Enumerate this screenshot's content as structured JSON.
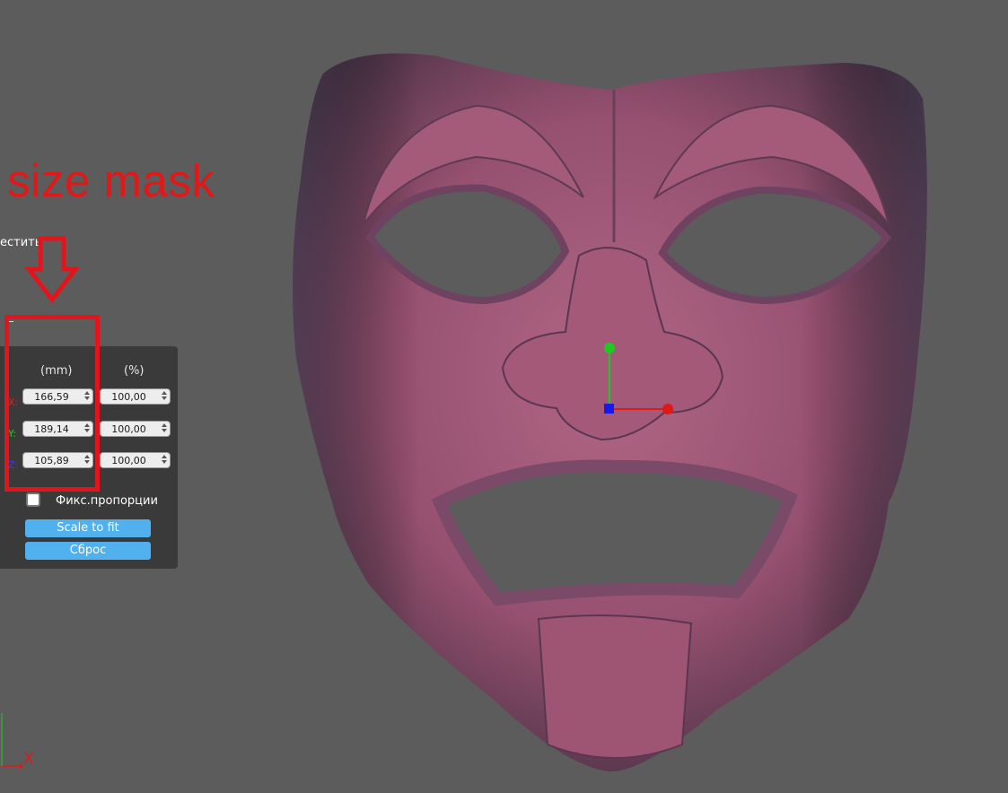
{
  "annotation": {
    "title": "size mask"
  },
  "menu": {
    "truncated_item": "естить"
  },
  "scale_panel": {
    "col_mm": "(mm)",
    "col_percent": "(%)",
    "rows": [
      {
        "axis": "X:",
        "axis_color": "#e02020",
        "mm": "166,59",
        "percent": "100,00"
      },
      {
        "axis": "Y:",
        "axis_color": "#2ec82e",
        "mm": "189,14",
        "percent": "100,00"
      },
      {
        "axis": "Z:",
        "axis_color": "#3a3ae8",
        "mm": "105,89",
        "percent": "100,00"
      }
    ],
    "fix_proportions": {
      "label": "Фикс.пропорции",
      "checked": false
    },
    "buttons": {
      "scale_to_fit": "Scale to fit",
      "reset": "Сброс"
    }
  },
  "viewport": {
    "model": "theatre-mask",
    "model_color": "#9a4e6b",
    "background": "#5c5c5c",
    "gizmo_colors": {
      "x": "#e01818",
      "y": "#22c822",
      "z": "#1818e8"
    },
    "triad_label": "X"
  },
  "colors": {
    "accent_button": "#51b0ee",
    "annotation_red": "#e3141c",
    "panel_bg": "#3a3a3a"
  }
}
